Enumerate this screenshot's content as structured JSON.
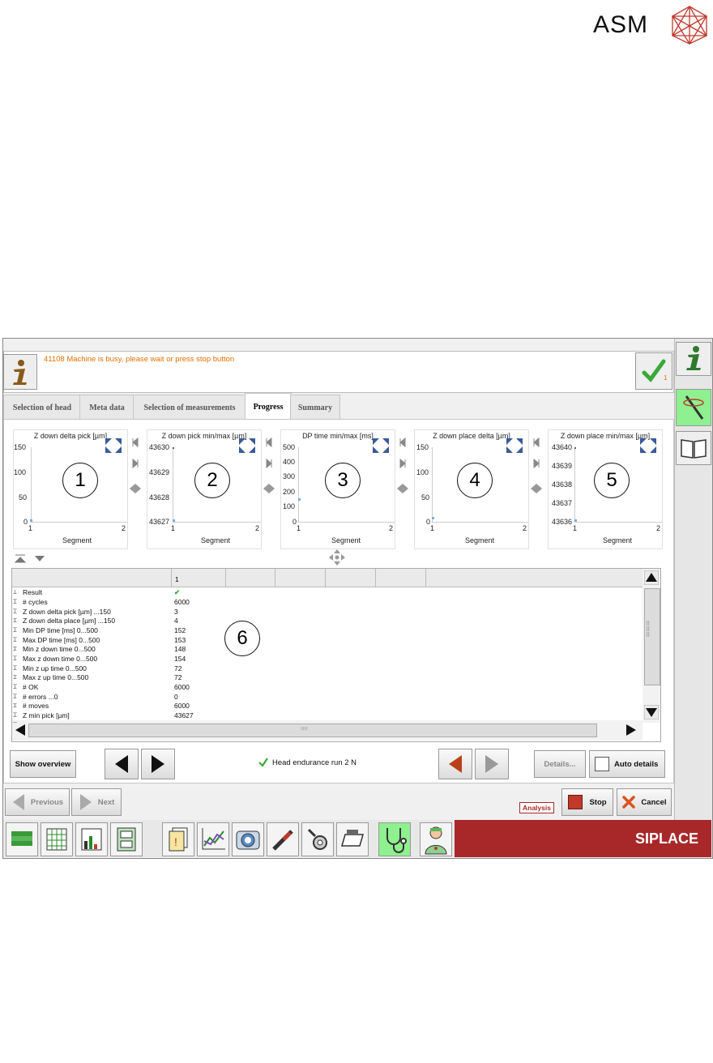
{
  "logo": {
    "text": "ASM"
  },
  "message": {
    "text": "41108 Machine is busy, please wait or press stop button",
    "ok_badge": "1"
  },
  "tabs": [
    {
      "label": "Selection of head"
    },
    {
      "label": "Meta data"
    },
    {
      "label": "Selection of measurements"
    },
    {
      "label": "Progress"
    },
    {
      "label": "Summary"
    }
  ],
  "charts": [
    {
      "title": "Z down delta pick [µm]",
      "yticks": [
        "150",
        "100",
        "50",
        "0"
      ],
      "xticks": [
        "1",
        "2"
      ],
      "xlabel": "Segment",
      "callout": "1"
    },
    {
      "title": "Z down pick min/max [µm]",
      "yticks": [
        "43630",
        "43629",
        "43628",
        "43627"
      ],
      "xticks": [
        "1",
        "2"
      ],
      "xlabel": "Segment",
      "callout": "2"
    },
    {
      "title": "DP time min/max [ms]",
      "yticks": [
        "500",
        "400",
        "300",
        "200",
        "100",
        "0"
      ],
      "xticks": [
        "1",
        "2"
      ],
      "xlabel": "Segment",
      "callout": "3"
    },
    {
      "title": "Z down place delta [µm]",
      "yticks": [
        "150",
        "100",
        "50",
        "0"
      ],
      "xticks": [
        "1",
        "2"
      ],
      "xlabel": "Segment",
      "callout": "4"
    },
    {
      "title": "Z down place min/max [µm]",
      "yticks": [
        "43640",
        "43639",
        "43638",
        "43637",
        "43636"
      ],
      "xticks": [
        "1",
        "2"
      ],
      "xlabel": "Segment",
      "callout": "5"
    }
  ],
  "table": {
    "column_header": "1",
    "callout": "6",
    "rows": [
      {
        "label": "Result",
        "value": "✔"
      },
      {
        "label": "# cycles",
        "value": "6000"
      },
      {
        "label": "Z down delta pick [µm] ...150",
        "value": "3"
      },
      {
        "label": "Z down delta place [µm] ...150",
        "value": "4"
      },
      {
        "label": "Min DP time [ms] 0...500",
        "value": "152"
      },
      {
        "label": "Max DP time [ms] 0...500",
        "value": "153"
      },
      {
        "label": "Min z down time 0...500",
        "value": "148"
      },
      {
        "label": "Max z down time 0...500",
        "value": "154"
      },
      {
        "label": "Min z up time 0...500",
        "value": "72"
      },
      {
        "label": "Max z up time 0...500",
        "value": "72"
      },
      {
        "label": "# OK",
        "value": "6000"
      },
      {
        "label": "# errors ...0",
        "value": "0"
      },
      {
        "label": "# moves",
        "value": "6000"
      },
      {
        "label": "Z min pick [µm]",
        "value": "43627"
      }
    ]
  },
  "controls": {
    "show_overview": "Show overview",
    "status_text": "Head endurance run 2 N",
    "details": "Details...",
    "auto_details": "Auto details"
  },
  "footer": {
    "previous": "Previous",
    "next": "Next",
    "analysis": "Analysis",
    "stop": "Stop",
    "cancel": "Cancel",
    "brand": "SIPLACE"
  },
  "colors": {
    "message": "#e07000",
    "brand_bar": "#a8282a",
    "active_rail": "#8ef08e",
    "ok_check": "#3aa83a"
  }
}
